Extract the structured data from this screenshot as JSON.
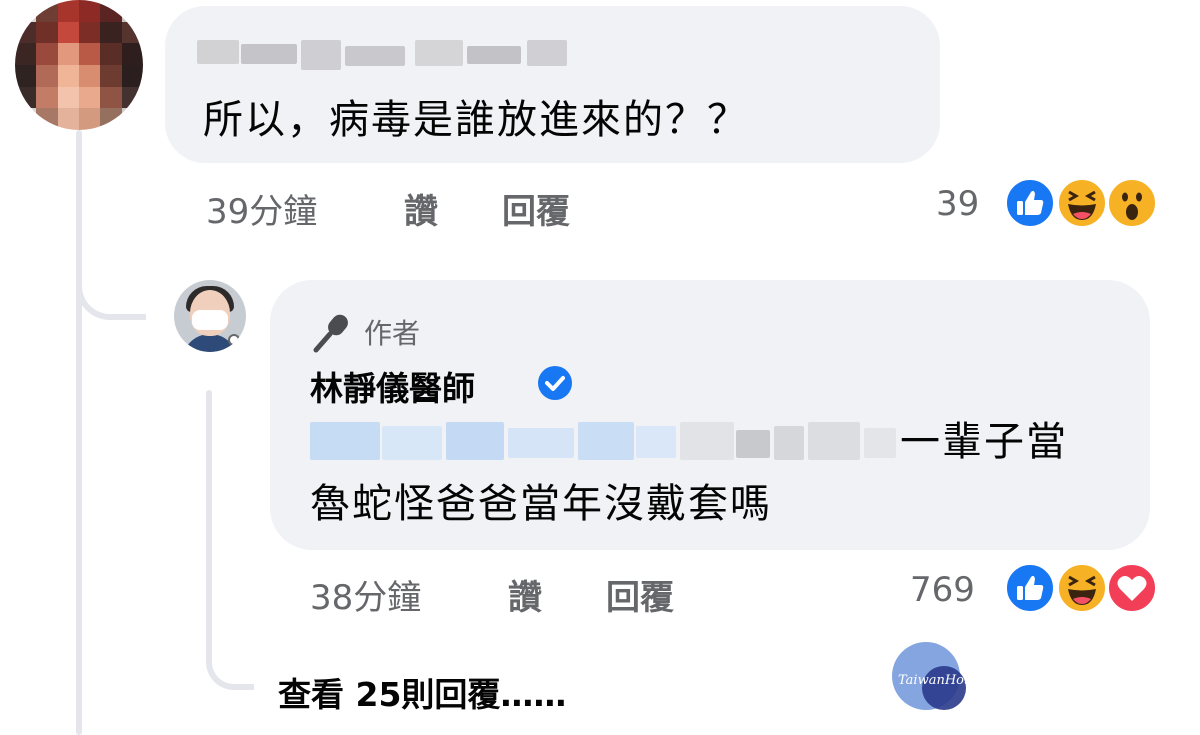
{
  "comment": {
    "text": "所以，病毒是誰放進來的？？",
    "time": "39分鐘",
    "like_label": "讚",
    "reply_label": "回覆",
    "reaction_count": "39",
    "reactions": [
      "like",
      "haha",
      "wow"
    ]
  },
  "reply": {
    "author_badge": "作者",
    "author_name": "林靜儀醫師",
    "text_line1_visible": "一輩子當",
    "text_line2": "魯蛇怪爸爸當年沒戴套嗎",
    "time": "38分鐘",
    "like_label": "讚",
    "reply_label": "回覆",
    "reaction_count": "769",
    "reactions": [
      "like",
      "haha",
      "love"
    ]
  },
  "view_more_replies": "查看 25則回覆……",
  "watermark": "TaiwanHot",
  "colors": {
    "bubble": "#f0f2f5",
    "meta_text": "#65676b",
    "like_blue": "#1877f2",
    "haha_yellow": "#f7b125",
    "love_red": "#f33e58"
  }
}
